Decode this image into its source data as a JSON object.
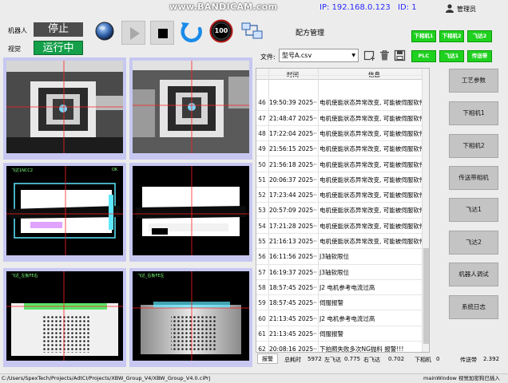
{
  "watermark": "www.BANDICAM.com",
  "header": {
    "ip": "IP: 192.168.0.123",
    "id": "ID: 1",
    "user": "管理员",
    "robot_label": "机器人",
    "vision_label": "视觉",
    "robot_status": "停止",
    "vision_status": "运行中",
    "speed": "100"
  },
  "config": {
    "title": "配方管理",
    "file_label": "文件:",
    "file_value": "型号A.csv"
  },
  "green_buttons": [
    "下相机1",
    "下相机2",
    "飞达2",
    "PLC",
    "飞达1",
    "传送带"
  ],
  "log": {
    "col_time": "时间",
    "col_info": "信息",
    "rows": [
      {
        "n": "45",
        "t": "",
        "m": ""
      },
      {
        "n": "46",
        "t": "19:50:39  2025···",
        "m": "电机使能状态异常改变, 可能被伺服软件"
      },
      {
        "n": "47",
        "t": "21:48:47  2025···",
        "m": "电机使能状态异常改变, 可能被伺服软件"
      },
      {
        "n": "48",
        "t": "17:22:04  2025···",
        "m": "电机使能状态异常改变, 可能被伺服软件"
      },
      {
        "n": "49",
        "t": "21:56:15  2025···",
        "m": "电机使能状态异常改变, 可能被伺服软件"
      },
      {
        "n": "50",
        "t": "21:56:18  2025···",
        "m": "电机使能状态异常改变, 可能被伺服软件"
      },
      {
        "n": "51",
        "t": "20:06:37  2025···",
        "m": "电机使能状态异常改变, 可能被伺服软件"
      },
      {
        "n": "52",
        "t": "17:23:44  2025···",
        "m": "电机使能状态异常改变, 可能被伺服软件"
      },
      {
        "n": "53",
        "t": "20:57:09  2025···",
        "m": "电机使能状态异常改变, 可能被伺服软件"
      },
      {
        "n": "54",
        "t": "17:21:28  2025···",
        "m": "电机使能状态异常改变, 可能被伺服软件"
      },
      {
        "n": "55",
        "t": "21:16:13  2025···",
        "m": "电机使能状态异常改变, 可能被伺服软件"
      },
      {
        "n": "56",
        "t": "16:11:56  2025···",
        "m": "J3轴软限位"
      },
      {
        "n": "57",
        "t": "16:19:37  2025···",
        "m": "J3轴软限位"
      },
      {
        "n": "58",
        "t": "18:57:45  2025···",
        "m": "J2 电机参考电流过高"
      },
      {
        "n": "59",
        "t": "18:57:45  2025···",
        "m": "伺服报警"
      },
      {
        "n": "60",
        "t": "21:13:45  2025···",
        "m": "J2 电机参考电流过高"
      },
      {
        "n": "61",
        "t": "21:13:45  2025···",
        "m": "伺服报警"
      },
      {
        "n": "62",
        "t": "20:08:16  2025···",
        "m": "下拍照失败多次NG抛料 报警!!!"
      }
    ]
  },
  "side_buttons": [
    "工艺参数",
    "下相机1",
    "下相机2",
    "传送带相机",
    "飞达1",
    "飞达2",
    "机器人调试",
    "系统日志"
  ],
  "bottom": {
    "tab": "报警",
    "total_label": "总耗时",
    "total": "5972",
    "left_label": "左飞达",
    "left": "0.775",
    "right_label": "右飞达",
    "right": "0.702",
    "cam_label": "下相机",
    "cam": "0",
    "belt_label": "传送带",
    "belt": "2.392"
  },
  "statusbar": {
    "path": "C:/Users/SpexTech/Projects/AdtCI/Projects/XBW_Group_V4/XBW_Group_V4.0.ciPrj",
    "right": "mainWindow  视觉加密狗已插入"
  },
  "camera_overlay_text": {
    "cam3_label": "飞达1NCC2",
    "cam3_ok": "OK",
    "cam5_label": "飞达_左板FE右",
    "cam6_label": "飞达_右板FE左"
  }
}
